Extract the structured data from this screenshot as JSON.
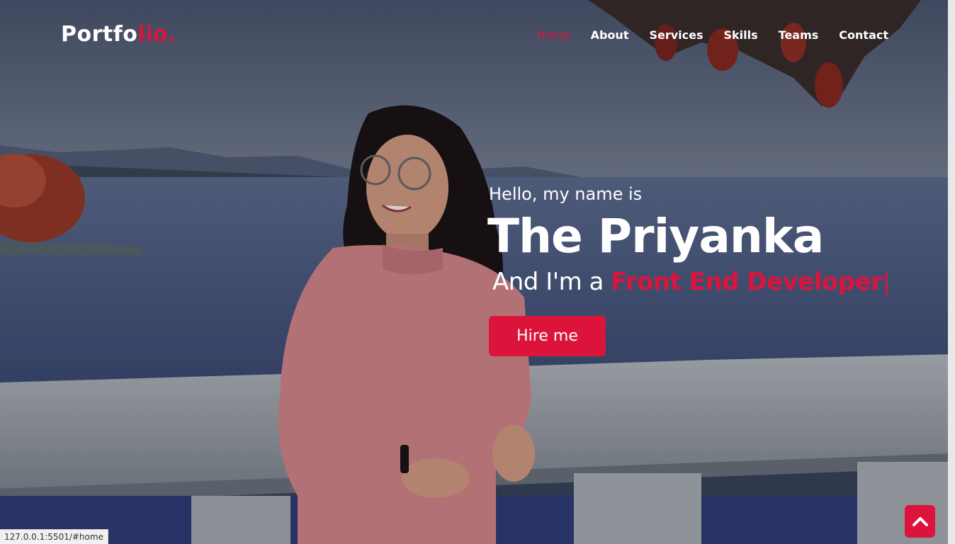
{
  "brand": {
    "name_main": "Portfo",
    "name_accent": "lio."
  },
  "nav": {
    "items": [
      {
        "label": "Home",
        "active": true
      },
      {
        "label": "About",
        "active": false
      },
      {
        "label": "Services",
        "active": false
      },
      {
        "label": "Skills",
        "active": false
      },
      {
        "label": "Teams",
        "active": false
      },
      {
        "label": "Contact",
        "active": false
      }
    ]
  },
  "hero": {
    "greeting": "Hello, my name is",
    "name": "The Priyanka",
    "role_prefix": "And I'm a ",
    "role_typed": "Front End Developer",
    "cursor": "|",
    "hire_button": "Hire me"
  },
  "scroll_up": {
    "icon": "chevron-up-icon"
  },
  "status_bar": {
    "url": "127.0.0.1:5501/#home"
  },
  "colors": {
    "accent": "#dc143c",
    "text": "#ffffff"
  }
}
